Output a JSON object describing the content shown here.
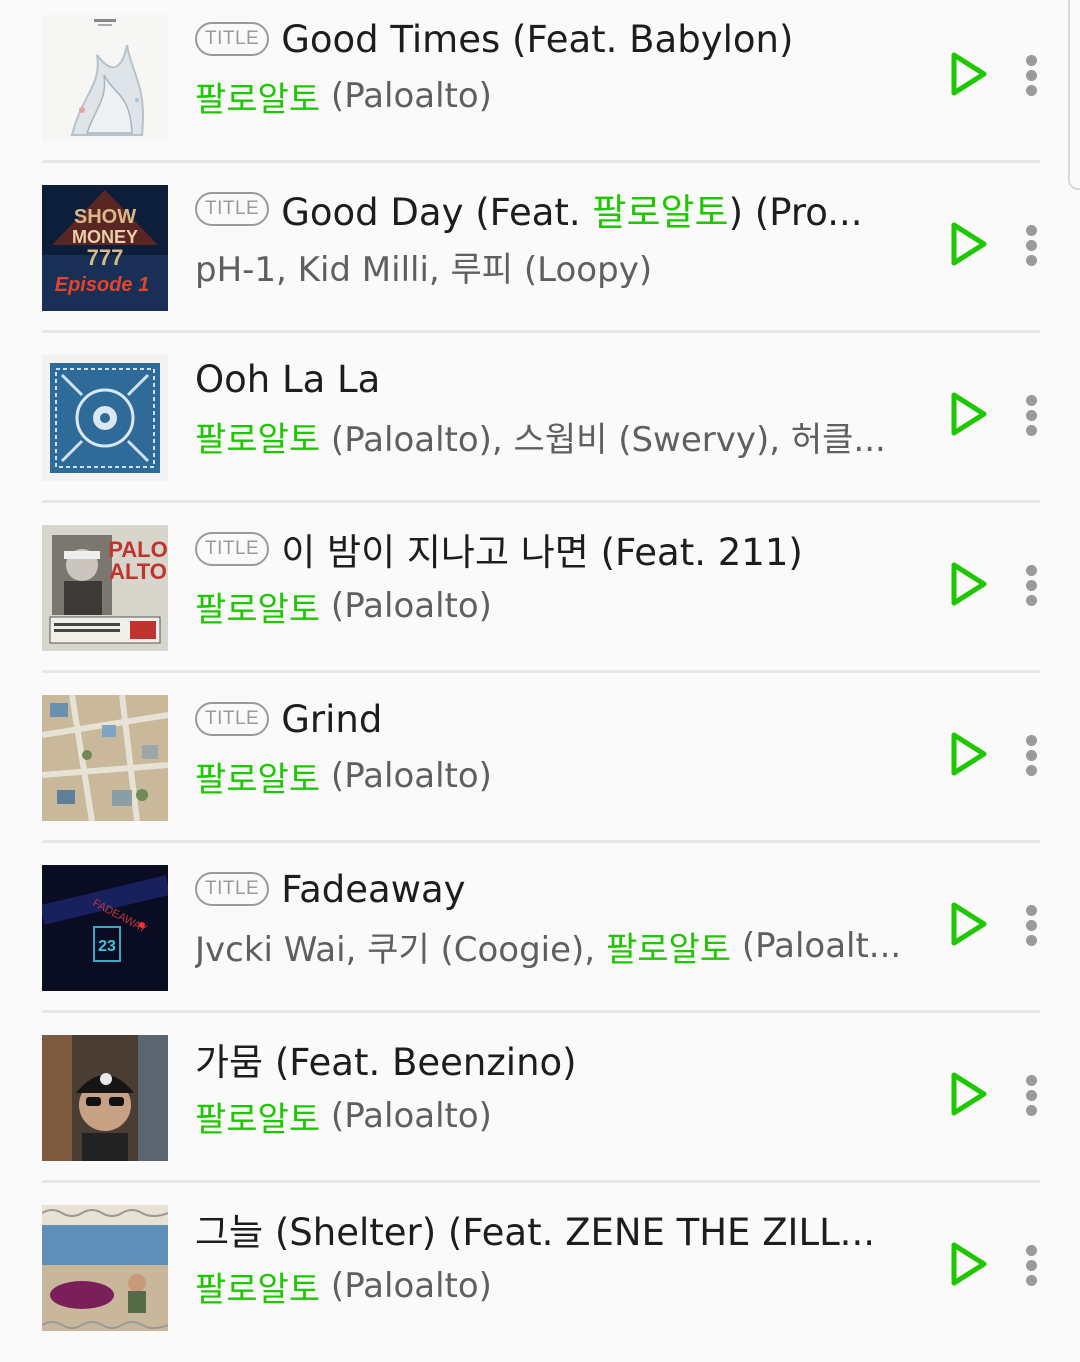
{
  "colors": {
    "accent": "#1ec800",
    "text": "#1d1d1d",
    "sub": "#5f5f5f",
    "badge": "#9a9a9a"
  },
  "badge_text": "TITLE",
  "tracks": [
    {
      "title": "Good Times (Feat. Babylon)",
      "has_badge": true,
      "artist_parts": [
        {
          "t": "팔로알토",
          "g": true
        },
        {
          "t": " (Paloalto)",
          "g": false
        }
      ],
      "art": "white-splash-cover"
    },
    {
      "title_parts": [
        {
          "t": "Good Day (Feat. ",
          "g": false
        },
        {
          "t": "팔로알토",
          "g": true
        },
        {
          "t": ") (Pro...",
          "g": false
        }
      ],
      "has_badge": true,
      "artist_parts": [
        {
          "t": "pH-1, Kid Milli, 루피 (Loopy)",
          "g": false
        }
      ],
      "art": "show-me-the-money-cover"
    },
    {
      "title": "Ooh La La",
      "has_badge": false,
      "artist_parts": [
        {
          "t": "팔로알토",
          "g": true
        },
        {
          "t": " (Paloalto), 스웝비 (Swervy), 허클...",
          "g": false
        }
      ],
      "art": "bandana-cover"
    },
    {
      "title": "이 밤이 지나고 나면 (Feat. 211)",
      "has_badge": true,
      "artist_parts": [
        {
          "t": "팔로알토",
          "g": true
        },
        {
          "t": " (Paloalto)",
          "g": false
        }
      ],
      "art": "palo-alto-portrait-cover"
    },
    {
      "title": "Grind",
      "has_badge": true,
      "artist_parts": [
        {
          "t": "팔로알토",
          "g": true
        },
        {
          "t": " (Paloalto)",
          "g": false
        }
      ],
      "art": "city-aerial-cover"
    },
    {
      "title": "Fadeaway",
      "has_badge": true,
      "artist_parts": [
        {
          "t": "Jvcki Wai, 쿠기 (Coogie), ",
          "g": false
        },
        {
          "t": "팔로알토",
          "g": true
        },
        {
          "t": " (Paloalt...",
          "g": false
        }
      ],
      "art": "dark-neon-cover"
    },
    {
      "title": "가뭄 (Feat. Beenzino)",
      "has_badge": false,
      "artist_parts": [
        {
          "t": "팔로알토",
          "g": true
        },
        {
          "t": " (Paloalto)",
          "g": false
        }
      ],
      "art": "street-portrait-cover"
    },
    {
      "title": "그늘 (Shelter) (Feat. ZENE THE ZILL...",
      "has_badge": false,
      "artist_parts": [
        {
          "t": "팔로알토",
          "g": true
        },
        {
          "t": " (Paloalto)",
          "g": false
        }
      ],
      "art": "beach-cover"
    }
  ]
}
